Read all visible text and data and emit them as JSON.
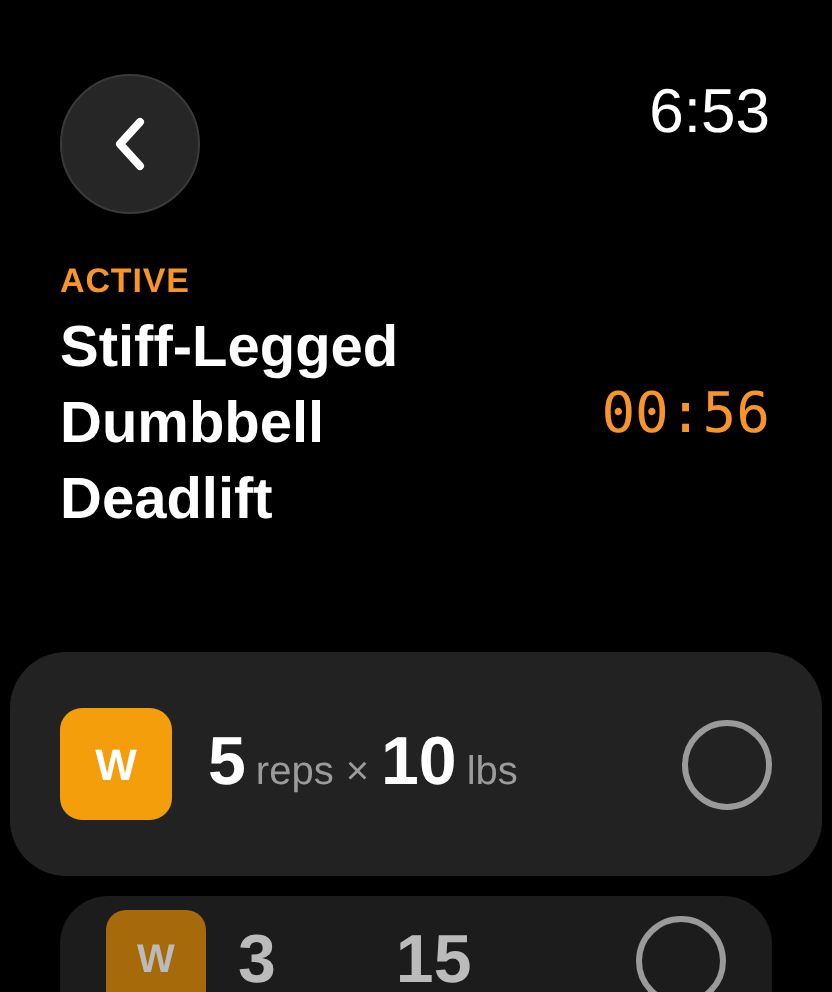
{
  "clock": "6:53",
  "exercise": {
    "status": "ACTIVE",
    "name_lines": [
      "Stiff-Legged",
      "Dumbbell",
      "Deadlift"
    ],
    "timer": "00:56"
  },
  "sets": [
    {
      "badge": "W",
      "reps": "5",
      "reps_unit": "reps",
      "times": "×",
      "weight": "10",
      "weight_unit": "lbs",
      "done": false,
      "focused": true
    },
    {
      "badge": "W",
      "reps": "3",
      "weight": "15",
      "done": false,
      "focused": false
    }
  ]
}
